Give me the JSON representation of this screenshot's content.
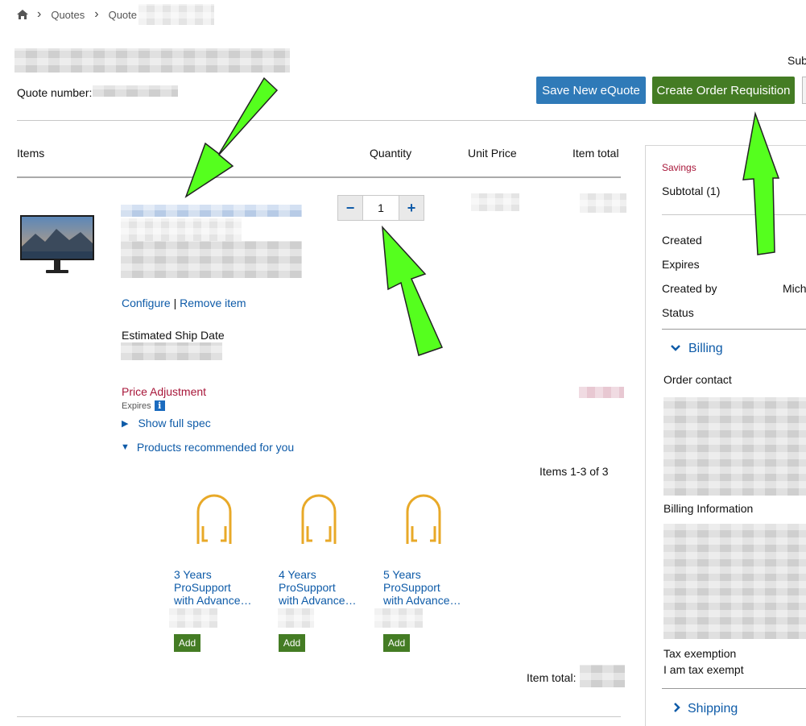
{
  "breadcrumb": {
    "home_icon": "home-icon",
    "items": [
      "Quotes",
      "Quote"
    ]
  },
  "header": {
    "quote_number_label": "Quote number:",
    "subtotal_short": "Sub",
    "save_button": "Save New eQuote",
    "create_button": "Create Order Requisition",
    "colors": {
      "save": "#2f7ab8",
      "create": "#447c24"
    }
  },
  "table": {
    "headers": {
      "items": "Items",
      "quantity": "Quantity",
      "unit_price": "Unit Price",
      "item_total": "Item total"
    }
  },
  "item": {
    "image_icon": "monitor-icon",
    "configure": "Configure",
    "separator": "|",
    "remove": "Remove item",
    "ship_label": "Estimated Ship Date",
    "price_adjustment": "Price Adjustment",
    "expires": "Expires",
    "info_icon": "i",
    "show_spec": "Show full spec",
    "recommended": "Products recommended for you",
    "quantity": {
      "value": "1",
      "minus": "−",
      "plus": "+"
    }
  },
  "recommendations": {
    "count_text": "Items 1-3 of 3",
    "products": [
      {
        "l1": "3 Years",
        "l2": "ProSupport",
        "l3": "with Advance…",
        "add": "Add"
      },
      {
        "l1": "4 Years",
        "l2": "ProSupport",
        "l3": "with Advance…",
        "add": "Add"
      },
      {
        "l1": "5 Years",
        "l2": "ProSupport",
        "l3": "with Advance…",
        "add": "Add"
      }
    ]
  },
  "item_total_label": "Item total:",
  "summary": {
    "savings": "Savings",
    "subtotal": "Subtotal (1)",
    "created": "Created",
    "expires": "Expires",
    "created_by": "Created by",
    "created_by_value": "Mich",
    "status": "Status",
    "billing": "Billing",
    "order_contact": "Order contact",
    "billing_info": "Billing Information",
    "tax_exemption": "Tax exemption",
    "tax_value": "I am tax exempt",
    "shipping": "Shipping"
  },
  "colors": {
    "link": "#0e5ba8",
    "accent_red": "#a8173a",
    "arrow": "#55ff1e"
  }
}
